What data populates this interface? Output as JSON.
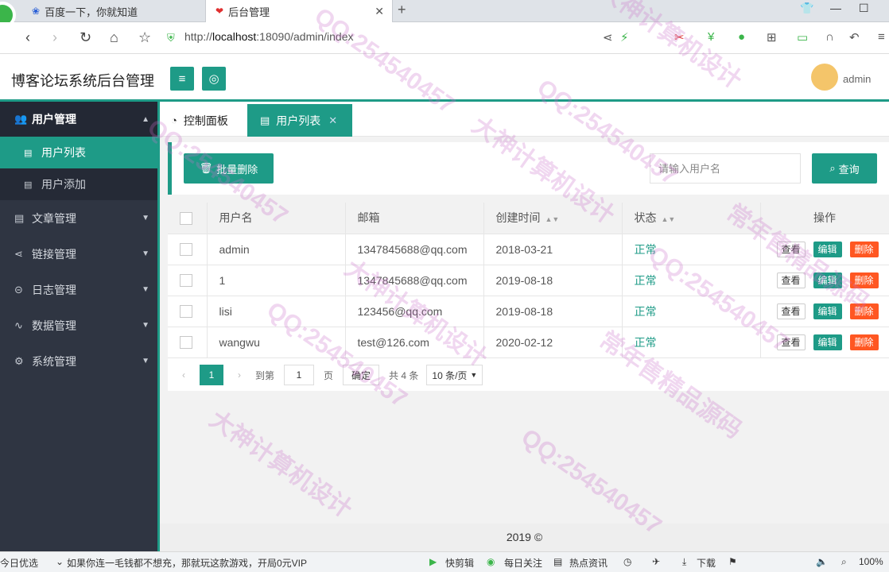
{
  "browser": {
    "tabs": [
      {
        "title": "百度一下，你就知道",
        "favicon": "baidu-paw-icon"
      },
      {
        "title": "后台管理",
        "favicon": "heart-icon"
      }
    ],
    "url_prefix": "http://",
    "url_host": "localhost",
    "url_rest": ":18090/admin/index"
  },
  "header": {
    "brand": "博客论坛系统后台管理",
    "user": "admin"
  },
  "sidebar": {
    "items": [
      {
        "label": "用户管理",
        "icon": "users-icon",
        "open": true
      },
      {
        "label": "文章管理",
        "icon": "article-icon"
      },
      {
        "label": "链接管理",
        "icon": "share-icon"
      },
      {
        "label": "日志管理",
        "icon": "log-icon"
      },
      {
        "label": "数据管理",
        "icon": "pulse-icon"
      },
      {
        "label": "系统管理",
        "icon": "cogs-icon"
      }
    ],
    "subitems": [
      {
        "label": "用户列表",
        "active": true
      },
      {
        "label": "用户添加"
      }
    ]
  },
  "content_tabs": [
    {
      "label": "控制面板",
      "icon": "dashboard-icon"
    },
    {
      "label": "用户列表",
      "icon": "list-icon"
    }
  ],
  "toolbar": {
    "batch_delete": "批量删除",
    "search_placeholder": "请输入用户名",
    "query": "查询"
  },
  "table": {
    "headers": [
      "用户名",
      "邮箱",
      "创建时间",
      "状态",
      "操作"
    ],
    "rows": [
      {
        "username": "admin",
        "email": "1347845688@qq.com",
        "created": "2018-03-21",
        "status": "正常"
      },
      {
        "username": "1",
        "email": "1347845688@qq.com",
        "created": "2019-08-18",
        "status": "正常"
      },
      {
        "username": "lisi",
        "email": "123456@qq.com",
        "created": "2019-08-18",
        "status": "正常"
      },
      {
        "username": "wangwu",
        "email": "test@126.com",
        "created": "2020-02-12",
        "status": "正常"
      }
    ],
    "actions": {
      "view": "查看",
      "edit": "编辑",
      "delete": "删除"
    }
  },
  "pager": {
    "current": "1",
    "goto_label": "到第",
    "page_input": "1",
    "page_unit": "页",
    "confirm": "确定",
    "total": "共 4 条",
    "page_size": "10 条/页"
  },
  "footer": "2019 ©",
  "statusbar": {
    "left1": "今日优选",
    "ad": "如果你连一毛钱都不想充，那就玩这款游戏，开局0元VIP",
    "items": [
      "快剪辑",
      "每日关注",
      "热点资讯",
      "下载"
    ],
    "zoom": "100%"
  },
  "watermarks": [
    "大神计算机设计",
    "QQ:254540457",
    "常年售精品源码"
  ]
}
